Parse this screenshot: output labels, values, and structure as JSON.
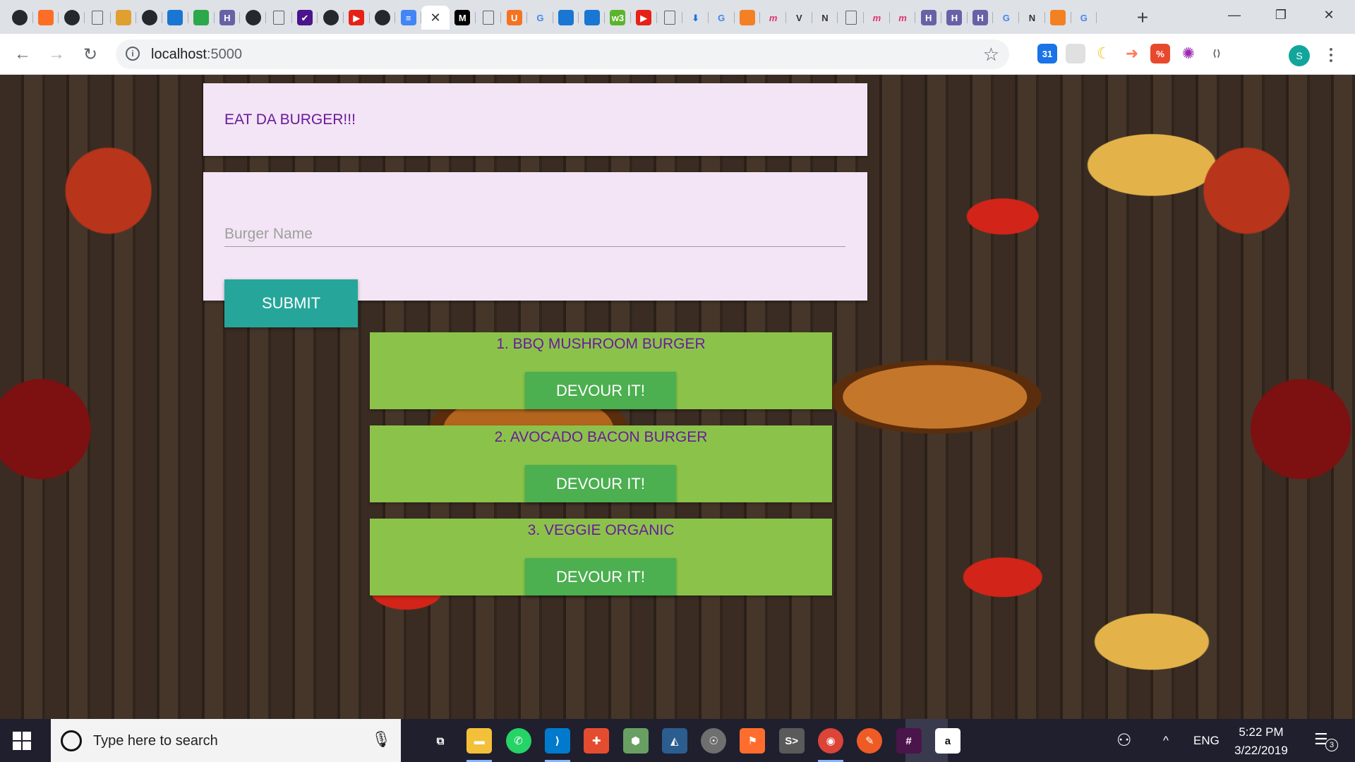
{
  "browser": {
    "tabs": [
      {
        "icon": "github-icon",
        "glyph": "",
        "color": "#24292e"
      },
      {
        "icon": "gitlab-icon",
        "glyph": "",
        "color": "#fc6d26"
      },
      {
        "icon": "github-icon",
        "glyph": "",
        "color": "#24292e"
      },
      {
        "icon": "document-icon",
        "glyph": "",
        "color": "#ffffff"
      },
      {
        "icon": "burger-icon",
        "glyph": "",
        "color": "#e0a030"
      },
      {
        "icon": "github-icon",
        "glyph": "",
        "color": "#24292e"
      },
      {
        "icon": "cube-icon",
        "glyph": "",
        "color": "#1976d2"
      },
      {
        "icon": "sequelize-icon",
        "glyph": "",
        "color": "#2ba84a"
      },
      {
        "icon": "heroku-icon",
        "glyph": "H",
        "color": "#6762a6"
      },
      {
        "icon": "github-icon",
        "glyph": "",
        "color": "#24292e"
      },
      {
        "icon": "document-icon",
        "glyph": "",
        "color": "#ffffff"
      },
      {
        "icon": "heroku-check-icon",
        "glyph": "✔",
        "color": "#4a148c"
      },
      {
        "icon": "github-icon",
        "glyph": "",
        "color": "#24292e"
      },
      {
        "icon": "youtube-icon",
        "glyph": "▶",
        "color": "#e62117"
      },
      {
        "icon": "github-icon",
        "glyph": "",
        "color": "#24292e"
      },
      {
        "icon": "google-docs-icon",
        "glyph": "≡",
        "color": "#4285f4"
      },
      {
        "icon": "close-icon",
        "glyph": "✕",
        "color": "#ffffff",
        "active": true
      },
      {
        "icon": "medium-icon",
        "glyph": "M",
        "color": "#000000"
      },
      {
        "icon": "document-icon",
        "glyph": "",
        "color": "#ffffff"
      },
      {
        "icon": "miami-u-icon",
        "glyph": "U",
        "color": "#f47321"
      },
      {
        "icon": "google-icon",
        "glyph": "G",
        "color": "#ffffff"
      },
      {
        "icon": "cube-icon",
        "glyph": "",
        "color": "#1976d2"
      },
      {
        "icon": "cube-icon",
        "glyph": "",
        "color": "#1976d2"
      },
      {
        "icon": "w3c-icon",
        "glyph": "w3",
        "color": "#5ab52c"
      },
      {
        "icon": "youtube-icon",
        "glyph": "▶",
        "color": "#e62117"
      },
      {
        "icon": "document-icon",
        "glyph": "",
        "color": "#ffffff"
      },
      {
        "icon": "download-icon",
        "glyph": "⬇",
        "color": "#ffffff"
      },
      {
        "icon": "google-icon",
        "glyph": "G",
        "color": "#ffffff"
      },
      {
        "icon": "stackoverflow-circle-icon",
        "glyph": "",
        "color": "#f48024"
      },
      {
        "icon": "mongo-m-icon",
        "glyph": "m",
        "color": "#ffffff"
      },
      {
        "icon": "v-icon",
        "glyph": "V",
        "color": "#ffffff"
      },
      {
        "icon": "notion-icon",
        "glyph": "N",
        "color": "#ffffff"
      },
      {
        "icon": "document-icon",
        "glyph": "",
        "color": "#ffffff"
      },
      {
        "icon": "mongo-m-icon",
        "glyph": "m",
        "color": "#ffffff"
      },
      {
        "icon": "mongo-m-icon",
        "glyph": "m",
        "color": "#ffffff"
      },
      {
        "icon": "heroku-icon",
        "glyph": "H",
        "color": "#6762a6"
      },
      {
        "icon": "heroku-icon",
        "glyph": "H",
        "color": "#6762a6"
      },
      {
        "icon": "heroku-icon",
        "glyph": "H",
        "color": "#6762a6"
      },
      {
        "icon": "google-icon",
        "glyph": "G",
        "color": "#ffffff"
      },
      {
        "icon": "notion-icon",
        "glyph": "N",
        "color": "#ffffff"
      },
      {
        "icon": "stackoverflow-icon",
        "glyph": "",
        "color": "#f48024"
      },
      {
        "icon": "google-icon",
        "glyph": "G",
        "color": "#ffffff"
      }
    ],
    "new_tab_glyph": "+",
    "window_controls": {
      "minimize": "—",
      "restore": "❐",
      "close": "✕"
    },
    "nav": {
      "back": "←",
      "forward": "→",
      "reload": "↻"
    },
    "address": {
      "host": "localhost",
      "port": ":5000",
      "info_glyph": "i"
    },
    "bookmark_glyph": "☆",
    "extensions": [
      {
        "icon": "calendar-extension-icon",
        "glyph": "31",
        "color": "#1a73e8"
      },
      {
        "icon": "blank-extension-icon",
        "glyph": "",
        "color": "#e0e0e0"
      },
      {
        "icon": "moon-extension-icon",
        "glyph": "☾",
        "color": "#f4c20d"
      },
      {
        "icon": "arrow-extension-icon",
        "glyph": "➜",
        "color": "#ff7a59"
      },
      {
        "icon": "percent-extension-icon",
        "glyph": "%",
        "color": "#e8492d"
      },
      {
        "icon": "colorwheel-extension-icon",
        "glyph": "✺",
        "color": "#9c27b0"
      },
      {
        "icon": "code-extension-icon",
        "glyph": "⟨⟩",
        "color": "#ffffff"
      }
    ],
    "profile_initial": "S"
  },
  "app": {
    "title": "EAT DA BURGER!!!",
    "form": {
      "placeholder": "Burger Name",
      "value": "",
      "submit_label": "SUBMIT"
    },
    "burgers": [
      {
        "label": "1. BBQ MUSHROOM BURGER",
        "button": "DEVOUR IT!"
      },
      {
        "label": "2. AVOCADO BACON BURGER",
        "button": "DEVOUR IT!"
      },
      {
        "label": "3. VEGGIE ORGANIC",
        "button": "DEVOUR IT!"
      }
    ]
  },
  "taskbar": {
    "search_placeholder": "Type here to search",
    "apps": [
      {
        "icon": "task-view-icon",
        "glyph": "⧉",
        "color": "#1f1f2e"
      },
      {
        "icon": "file-explorer-icon",
        "glyph": "▬",
        "color": "#f3c03a",
        "running": true
      },
      {
        "icon": "whatsapp-icon",
        "glyph": "✆",
        "color": "#25d366"
      },
      {
        "icon": "vscode-icon",
        "glyph": "⟩",
        "color": "#007acc",
        "running": true
      },
      {
        "icon": "git-kraken-icon",
        "glyph": "✚",
        "color": "#e44c30"
      },
      {
        "icon": "node-icon",
        "glyph": "⬢",
        "color": "#68a063"
      },
      {
        "icon": "mysql-workbench-icon",
        "glyph": "◭",
        "color": "#2c5d8f"
      },
      {
        "icon": "postgres-icon",
        "glyph": "☉",
        "color": "#6f6f6f"
      },
      {
        "icon": "flag-app-icon",
        "glyph": "⚑",
        "color": "#ff6d2e"
      },
      {
        "icon": "snip-icon",
        "glyph": "S>",
        "color": "#5a5a5a"
      },
      {
        "icon": "chrome-icon",
        "glyph": "◉",
        "color": "#db4437",
        "running": true
      },
      {
        "icon": "postman-icon",
        "glyph": "✎",
        "color": "#ef5b25"
      },
      {
        "icon": "slack-icon",
        "glyph": "#",
        "color": "#4a154b"
      },
      {
        "icon": "amazon-icon",
        "glyph": "a",
        "color": "#ffffff"
      }
    ],
    "tray": {
      "people_glyph": "⚇",
      "chevron_glyph": "^",
      "language": "ENG"
    },
    "clock": {
      "time": "5:22 PM",
      "date": "3/22/2019"
    },
    "notification_count": "3"
  },
  "colors": {
    "card_purple_bg": "#f3e5f5",
    "heading_purple": "#6a1b9a",
    "submit_teal": "#26a69a",
    "card_green": "#8bc34a",
    "button_green": "#4caf50"
  }
}
